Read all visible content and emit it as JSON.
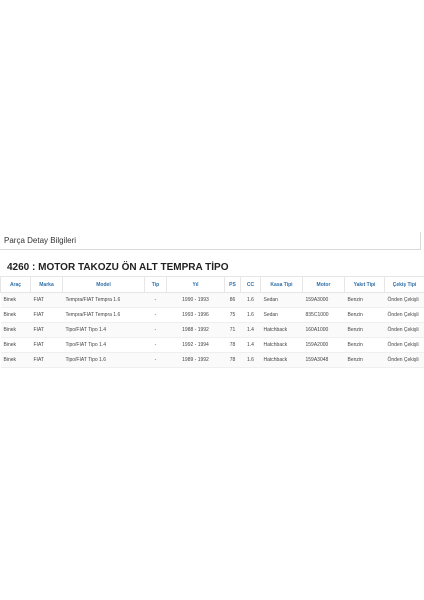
{
  "panel": {
    "title": "Parça Detay Bilgileri"
  },
  "part": {
    "title": "4260 : MOTOR TAKOZU ÖN ALT TEMPRA TİPO"
  },
  "table": {
    "headers": {
      "arac": "Araç",
      "marka": "Marka",
      "model": "Model",
      "tip": "Tip",
      "yil": "Yıl",
      "ps": "PS",
      "cc": "CC",
      "kasa": "Kasa Tipi",
      "motor": "Motor",
      "yakit": "Yakıt Tipi",
      "cekis": "Çekiş Tipi"
    },
    "rows": [
      {
        "arac": "Binek",
        "marka": "FIAT",
        "model": "Tempra/FIAT Tempra 1.6",
        "tip": "-",
        "yil": "1990 - 1993",
        "ps": "86",
        "cc": "1.6",
        "kasa": "Sedan",
        "motor": "159A3000",
        "yakit": "Benzin",
        "cekis": "Önden Çekişli"
      },
      {
        "arac": "Binek",
        "marka": "FIAT",
        "model": "Tempra/FIAT Tempra 1.6",
        "tip": "-",
        "yil": "1993 - 1996",
        "ps": "75",
        "cc": "1.6",
        "kasa": "Sedan",
        "motor": "835C1000",
        "yakit": "Benzin",
        "cekis": "Önden Çekişli"
      },
      {
        "arac": "Binek",
        "marka": "FIAT",
        "model": "Tipo/FIAT Tipo 1.4",
        "tip": "-",
        "yil": "1988 - 1992",
        "ps": "71",
        "cc": "1.4",
        "kasa": "Hatchback",
        "motor": "160A1000",
        "yakit": "Benzin",
        "cekis": "Önden Çekişli"
      },
      {
        "arac": "Binek",
        "marka": "FIAT",
        "model": "Tipo/FIAT Tipo 1.4",
        "tip": "-",
        "yil": "1992 - 1994",
        "ps": "78",
        "cc": "1.4",
        "kasa": "Hatchback",
        "motor": "159A2000",
        "yakit": "Benzin",
        "cekis": "Önden Çekişli"
      },
      {
        "arac": "Binek",
        "marka": "FIAT",
        "model": "Tipo/FIAT Tipo 1.6",
        "tip": "-",
        "yil": "1989 - 1992",
        "ps": "78",
        "cc": "1.6",
        "kasa": "Hatchback",
        "motor": "159A3048",
        "yakit": "Benzin",
        "cekis": "Önden Çekişli"
      }
    ]
  }
}
